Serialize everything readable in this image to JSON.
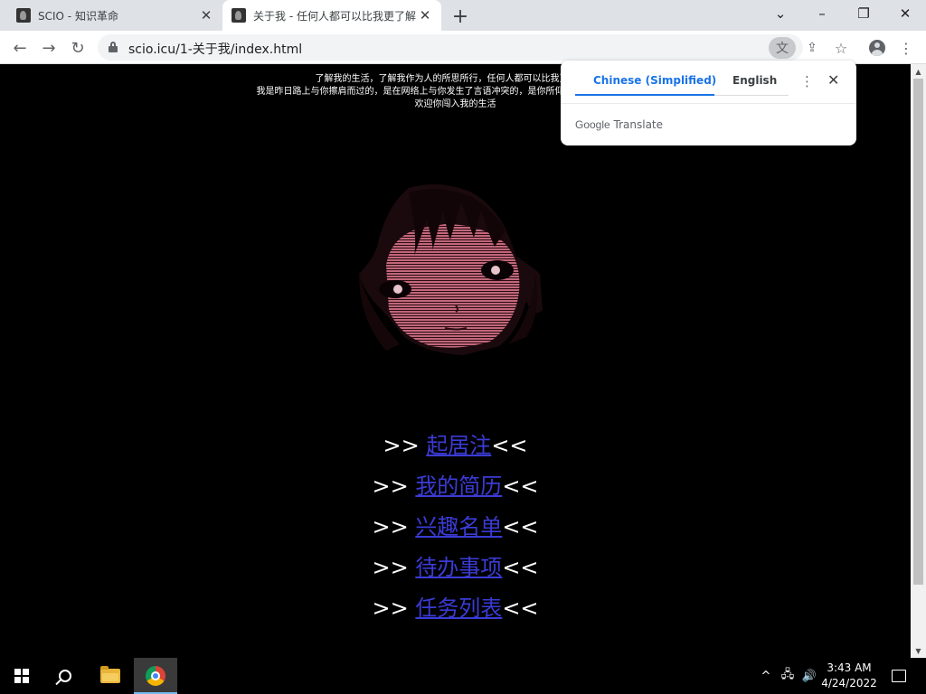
{
  "browser": {
    "tabs": [
      {
        "title": "SCIO - 知识革命"
      },
      {
        "title": "关于我 - 任何人都可以比我更了解"
      }
    ],
    "url": "scio.icu/1-关于我/index.html"
  },
  "translate_bubble": {
    "source_lang": "Chinese (Simplified)",
    "target_lang": "English",
    "footer_brand": "Google",
    "footer_label": "Translate"
  },
  "page": {
    "intro_lines": [
      "了解我的生活，了解我作为人的所思所行，任何人都可以比我更了解我",
      "我是昨日路上与你擦肩而过的，是在网络上与你发生了言语冲突的，是你所仰慕的，亦是你所痛恨的",
      "欢迎你闯入我的生活"
    ],
    "menu_prefix": ">>",
    "menu_suffix": "<<",
    "menu": [
      {
        "label": "起居注"
      },
      {
        "label": "我的简历"
      },
      {
        "label": "兴趣名单"
      },
      {
        "label": "待办事项"
      },
      {
        "label": "任务列表"
      }
    ]
  },
  "taskbar": {
    "time": "3:43 AM",
    "date": "4/24/2022"
  },
  "colors": {
    "link": "#3b3bd6",
    "portrait": "#c2677a",
    "accent": "#1a73e8"
  }
}
